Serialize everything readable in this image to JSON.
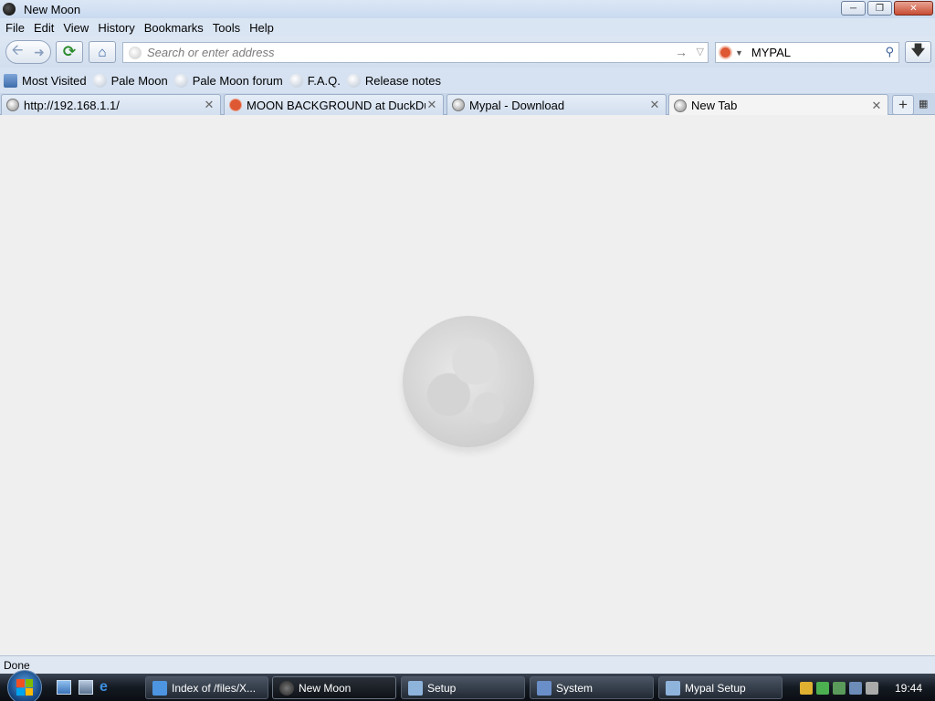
{
  "window": {
    "title": "New Moon"
  },
  "menu": [
    "File",
    "Edit",
    "View",
    "History",
    "Bookmarks",
    "Tools",
    "Help"
  ],
  "navbar": {
    "address_placeholder": "Search or enter address",
    "search_engine_icon": "duckduckgo-icon",
    "search_value": "MYPAL"
  },
  "bookmarks": [
    "Most Visited",
    "Pale Moon",
    "Pale Moon forum",
    "F.A.Q.",
    "Release notes"
  ],
  "tabs": [
    {
      "label": "http://192.168.1.1/",
      "icon": "globe-icon",
      "selected": false
    },
    {
      "label": "MOON BACKGROUND at DuckDuck...",
      "icon": "duckduckgo-icon",
      "selected": false
    },
    {
      "label": "Mypal - Download",
      "icon": "globe-icon",
      "selected": false
    },
    {
      "label": "New Tab",
      "icon": "globe-icon",
      "selected": true
    }
  ],
  "status": "Done",
  "taskbar": {
    "tasks": [
      {
        "label": "Index of /files/X...",
        "active": false
      },
      {
        "label": "New Moon",
        "active": true
      },
      {
        "label": "Setup",
        "active": false
      },
      {
        "label": "System",
        "active": false
      },
      {
        "label": "Mypal Setup",
        "active": false
      }
    ],
    "clock": "19:44"
  },
  "colors": {
    "chrome": "#d6e2f1",
    "content_bg": "#efefef",
    "taskbar": "#141a22"
  }
}
